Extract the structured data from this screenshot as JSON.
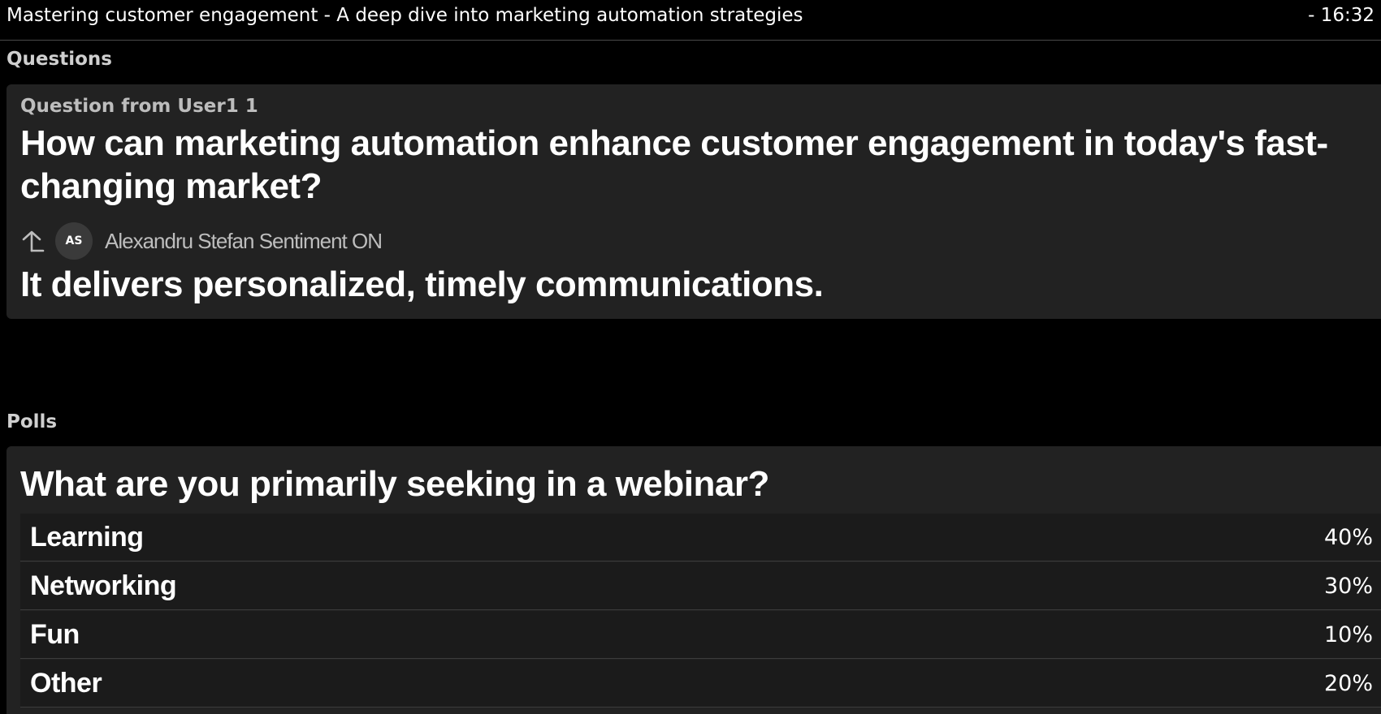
{
  "header": {
    "title": "Mastering customer engagement - A deep dive into marketing automation strategies",
    "time": "- 16:32"
  },
  "questions": {
    "section_label": "Questions",
    "items": [
      {
        "meta": "Question from User1 1",
        "text": "How can marketing automation enhance customer engagement in today's fast-changing market?",
        "reply": {
          "icon": "reply-arrow-icon",
          "avatar_initials": "AS",
          "author": "Alexandru Stefan Sentiment ON",
          "text": "It delivers personalized, timely communications."
        }
      }
    ]
  },
  "polls": {
    "section_label": "Polls",
    "items": [
      {
        "question": "What are you primarily seeking in a webinar?",
        "options": [
          {
            "label": "Learning",
            "percent": "40%",
            "value": 40
          },
          {
            "label": "Networking",
            "percent": "30%",
            "value": 30
          },
          {
            "label": "Fun",
            "percent": "10%",
            "value": 10
          },
          {
            "label": "Other",
            "percent": "20%",
            "value": 20
          }
        ]
      }
    ]
  },
  "colors": {
    "background": "#000000",
    "card": "#222222",
    "option_row": "#1b1b1b",
    "muted_text": "#bdbdbd",
    "divider": "#3c3c3c"
  }
}
